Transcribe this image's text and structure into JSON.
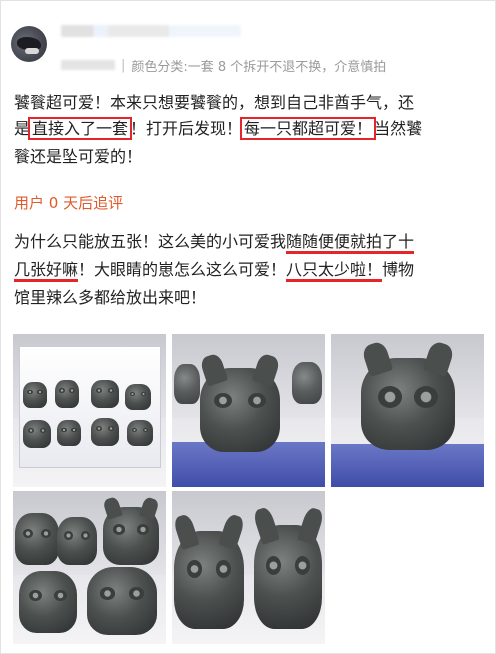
{
  "post": {
    "meta_variant": "颜色分类:一套 8 个拆开不退不换，介意慎拍",
    "review": {
      "line1": "饕餮超可爱！本来只想要饕餮的，想到自己非酋手气，还",
      "line2_a": "是",
      "line2_highlight1": "直接入了一套",
      "line2_b": "！打开后发现！",
      "line2_highlight2": "每一只都超可爱！",
      "line2_c": "当然饕",
      "line3": "餮还是坠可爱的！"
    },
    "followup_label": "用户 0 天后追评",
    "followup": {
      "line1_a": "为什么只能放五张！这么美的小可爱我",
      "line1_underline": "随随便便就拍了十",
      "line2_underline": "几张好嘛",
      "line2_b": "！大眼睛的崽怎么这么可爱！",
      "line2_underline2": "八只太少啦！",
      "line2_c": "博物",
      "line3": "馆里辣么多都给放出来吧！"
    }
  },
  "photos": [
    {
      "label": "photo-1-boxed-set"
    },
    {
      "label": "photo-2-taotie-figure"
    },
    {
      "label": "photo-3-big-eye-mask-figure"
    },
    {
      "label": "photo-4-group-figures"
    },
    {
      "label": "photo-5-two-figures"
    }
  ],
  "colors": {
    "highlight_red": "#e4262a",
    "followup_orange": "#e15a2b",
    "meta_gray": "#9a9a9a",
    "display_blue": "#4553b0"
  },
  "icons": {
    "avatar": "bird-avatar-icon"
  }
}
